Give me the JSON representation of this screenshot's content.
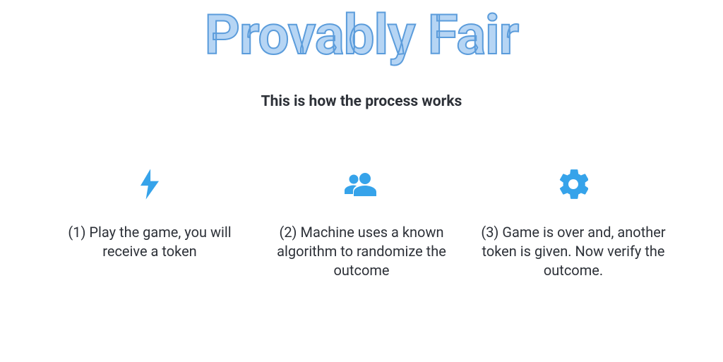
{
  "title": "Provably Fair",
  "subtitle": "This is how the process works",
  "steps": [
    {
      "icon": "bolt-icon",
      "text": "(1) Play the game, you will receive a token"
    },
    {
      "icon": "people-icon",
      "text": "(2) Machine uses a known algorithm to randomize the outcome"
    },
    {
      "icon": "gear-icon",
      "text": "(3) Game is over and, another token is given. Now verify the outcome."
    }
  ],
  "colors": {
    "accent": "#36a3ea",
    "titleFill": "#b6d5f4",
    "titleStroke": "#5b9cdb",
    "text": "#2d3138"
  }
}
